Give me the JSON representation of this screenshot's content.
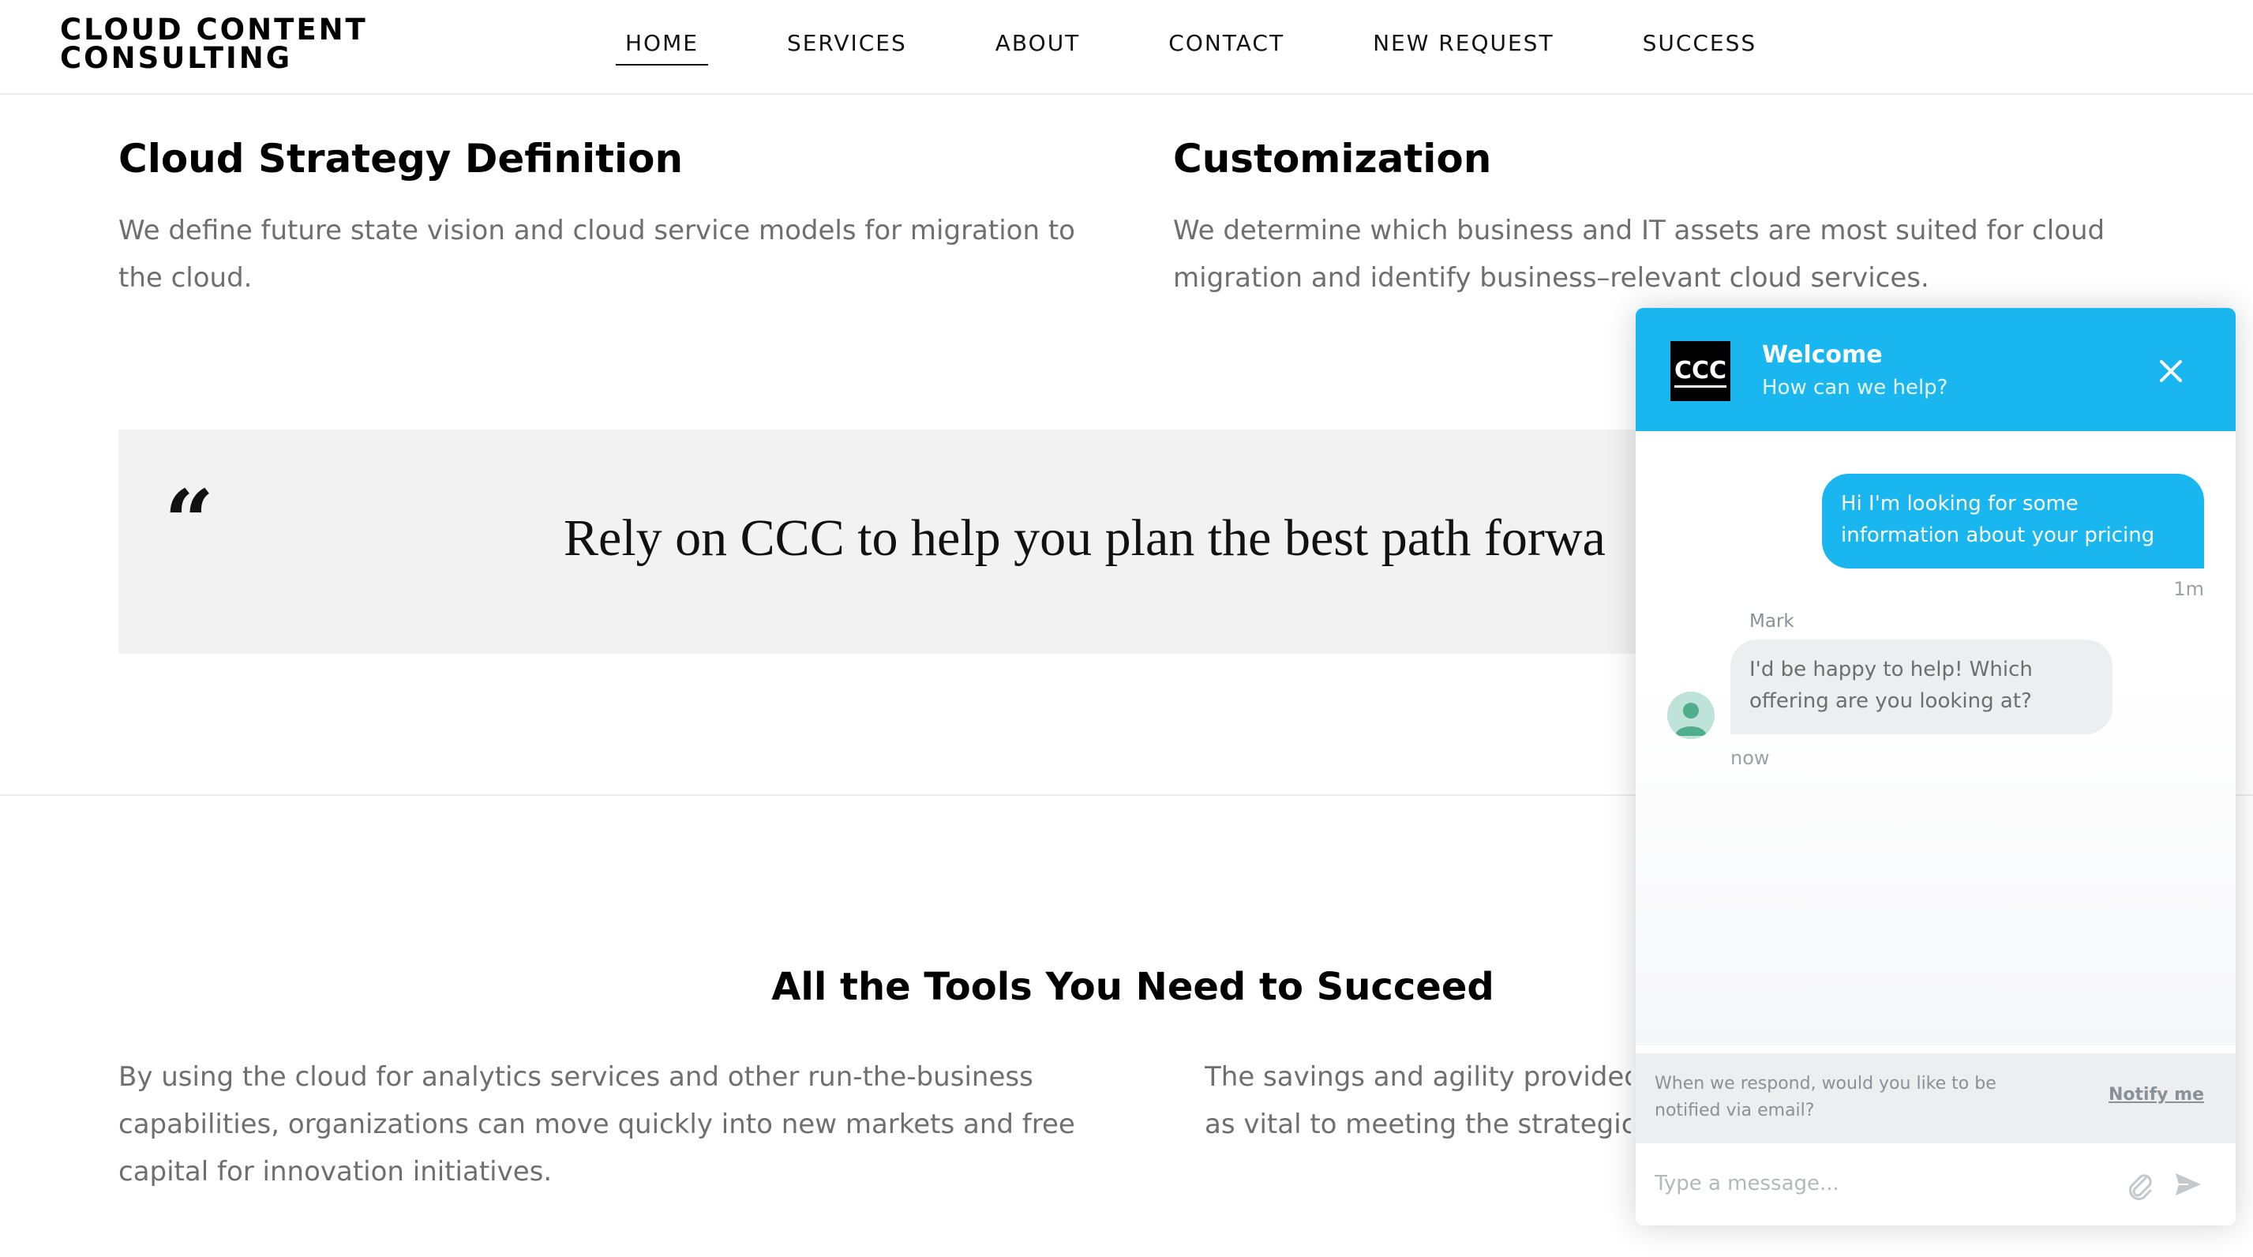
{
  "header": {
    "logo_line1": "CLOUD CONTENT",
    "logo_line2": "CONSULTING",
    "nav": [
      "HOME",
      "SERVICES",
      "ABOUT",
      "CONTACT",
      "NEW REQUEST",
      "SUCCESS"
    ],
    "active_nav": "HOME"
  },
  "features": [
    {
      "title": "Cloud Strategy Definition",
      "text": "We define future state vision and cloud service models for migration to the cloud."
    },
    {
      "title": "Customization",
      "text": "We determine which business and IT assets are most suited for cloud migration and identify business–relevant cloud services."
    }
  ],
  "quote": {
    "mark": "“",
    "text": "Rely on CCC to help you plan the best path forwa"
  },
  "tools": {
    "title": "All the Tools You Need to Succeed",
    "col1": "By using the cloud for analytics services and other run-the-business capabilities, organizations can move quickly into new markets and free capital for innovation initiatives.",
    "col2_line1": "The savings and agility provided",
    "col2_line2": "as vital to meeting the strategic a"
  },
  "chat": {
    "logo_text": "CCC",
    "title": "Welcome",
    "subtitle": "How can we help?",
    "messages": [
      {
        "from": "user",
        "text": "Hi I'm looking for some information about your pricing",
        "time": "1m"
      },
      {
        "from": "agent",
        "name": "Mark",
        "text": "I'd be happy to help! Which offering are you looking at?",
        "time": "now"
      }
    ],
    "notify_text": "When we respond, would you like to be notified via email?",
    "notify_link": "Notify me",
    "input_placeholder": "Type a message...",
    "accent_color": "#19b6f0"
  },
  "icons": {
    "close": "close-icon",
    "attach": "paperclip-icon",
    "send": "send-icon",
    "avatar": "user-avatar-icon"
  }
}
